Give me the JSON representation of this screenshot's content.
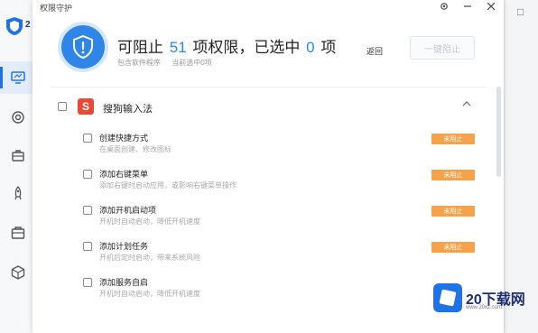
{
  "background_app": {
    "logo_suffix": "2",
    "nav_icons": [
      "monitor-icon",
      "target-icon",
      "toolbox-icon",
      "rocket-icon",
      "briefcase-icon",
      "cube-icon"
    ]
  },
  "dialog": {
    "title": "权限守护",
    "headline_prefix": "可阻止",
    "blockable_count": "51",
    "headline_mid": "项权限，已选中",
    "selected_count": "0",
    "headline_suffix": "项",
    "sub_labels": [
      "包含软件程序",
      "当前选中0项"
    ],
    "back_label": "返回",
    "block_button_label": "一键阻止"
  },
  "group": {
    "name": "搜狗输入法",
    "icon_glyph": "S"
  },
  "permissions": [
    {
      "title": "创建快捷方式",
      "desc": "在桌面创建、修改图标",
      "status": "未阻止"
    },
    {
      "title": "添加右键菜单",
      "desc": "添加右键时启动应用，或影响右键菜单操作",
      "status": "未阻止"
    },
    {
      "title": "添加开机启动项",
      "desc": "开机时自动启动，降低开机速度",
      "status": "未阻止"
    },
    {
      "title": "添加计划任务",
      "desc": "开机后定时启动，带来系统风险",
      "status": "未阻止"
    },
    {
      "title": "添加服务自启",
      "desc": "开机时自动启动，降低开机速度",
      "status": ""
    }
  ],
  "watermark": {
    "text": "20下载网",
    "url": "www.20xz.com"
  },
  "colors": {
    "accent": "#2f86e8",
    "status_bg": "#f5a34a",
    "app_icon_bg": "#e84a35"
  }
}
